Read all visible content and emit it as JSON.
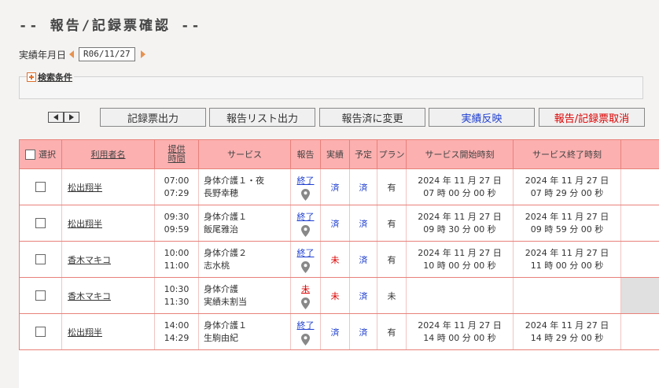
{
  "page_title": "-- 報告/記録票確認 --",
  "date_label": "実績年月日",
  "date_value": "R06/11/27",
  "search_label": "検索条件",
  "buttons": {
    "print_records": "記録票出力",
    "print_report_list": "報告リスト出力",
    "mark_reported": "報告済に変更",
    "apply_results": "実績反映",
    "cancel_report": "報告/記録票取消"
  },
  "table": {
    "headers": {
      "select": "選択",
      "user": "利用者名",
      "provided_time_1": "提供",
      "provided_time_2": "時間",
      "service": "サービス",
      "report": "報告",
      "result": "実績",
      "plan": "予定",
      "planning": "プラン",
      "start": "サービス開始時刻",
      "end": "サービス終了時刻"
    },
    "rows": [
      {
        "user": "松出翔半",
        "time_start": "07:00",
        "time_end": "07:29",
        "service": "身体介護１・夜",
        "staff": "長野幸穂",
        "report": "終了",
        "result": "済",
        "plan": "済",
        "planning": "有",
        "start_date": "2024 年 11 月 27 日",
        "start_time": "07 時 00 分 00 秒",
        "end_date": "2024 年 11 月 27 日",
        "end_time": "07 時 29 分 00 秒"
      },
      {
        "user": "松出翔半",
        "time_start": "09:30",
        "time_end": "09:59",
        "service": "身体介護１",
        "staff": "飯尾雅治",
        "report": "終了",
        "result": "済",
        "plan": "済",
        "planning": "有",
        "start_date": "2024 年 11 月 27 日",
        "start_time": "09 時 30 分 00 秒",
        "end_date": "2024 年 11 月 27 日",
        "end_time": "09 時 59 分 00 秒"
      },
      {
        "user": "香木マキコ",
        "time_start": "10:00",
        "time_end": "11:00",
        "service": "身体介護２",
        "staff": "志水桃",
        "report": "終了",
        "result": "未",
        "plan": "済",
        "planning": "有",
        "start_date": "2024 年 11 月 27 日",
        "start_time": "10 時 00 分 00 秒",
        "end_date": "2024 年 11 月 27 日",
        "end_time": "11 時 00 分 00 秒"
      },
      {
        "user": "香木マキコ",
        "time_start": "10:30",
        "time_end": "11:30",
        "service": "身体介護",
        "staff": "実績未割当",
        "report": "未",
        "result": "未",
        "plan": "済",
        "planning": "未",
        "start_date": "",
        "start_time": "",
        "end_date": "",
        "end_time": ""
      },
      {
        "user": "松出翔半",
        "time_start": "14:00",
        "time_end": "14:29",
        "service": "身体介護１",
        "staff": "生駒由紀",
        "report": "終了",
        "result": "済",
        "plan": "済",
        "planning": "有",
        "start_date": "2024 年 11 月 27 日",
        "start_time": "14 時 00 分 00 秒",
        "end_date": "2024 年 11 月 27 日",
        "end_time": "14 時 29 分 00 秒"
      }
    ]
  },
  "colors": {
    "header_bg": "#fcb0b0",
    "border": "#e8817a",
    "blue_status": "#1f3fd0",
    "red_status": "#dd0000",
    "cancel_text": "#dd0000",
    "apply_text": "#1f3fd0"
  }
}
